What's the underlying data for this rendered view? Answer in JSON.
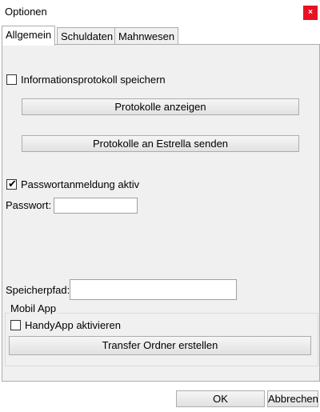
{
  "window": {
    "title": "Optionen",
    "close_glyph": "×"
  },
  "tabs": [
    {
      "label": "Allgemein",
      "active": true
    },
    {
      "label": "Schuldaten",
      "active": false
    },
    {
      "label": "Mahnwesen",
      "active": false
    }
  ],
  "general": {
    "info_protocol": {
      "label": "Informationsprotokoll speichern",
      "checked": false
    },
    "show_protocols_button": "Protokolle anzeigen",
    "send_protocols_button": "Protokolle an Estrella senden",
    "password_login": {
      "label": "Passwortanmeldung aktiv",
      "checked": true,
      "mark": "✔"
    },
    "password": {
      "label": "Passwort:",
      "value": ""
    },
    "storage_path": {
      "label": "Speicherpfad:",
      "value": ""
    }
  },
  "mobile_app": {
    "group_title": "Mobil App",
    "handy_app": {
      "label": "HandyApp aktivieren",
      "checked": false
    },
    "transfer_button": "Transfer Ordner erstellen"
  },
  "footer": {
    "ok_button": "OK",
    "cancel_button": "Abbrechen"
  },
  "colors": {
    "close_button": "#e81123",
    "panel_background": "#f0f0f0",
    "border": "#adadad"
  }
}
